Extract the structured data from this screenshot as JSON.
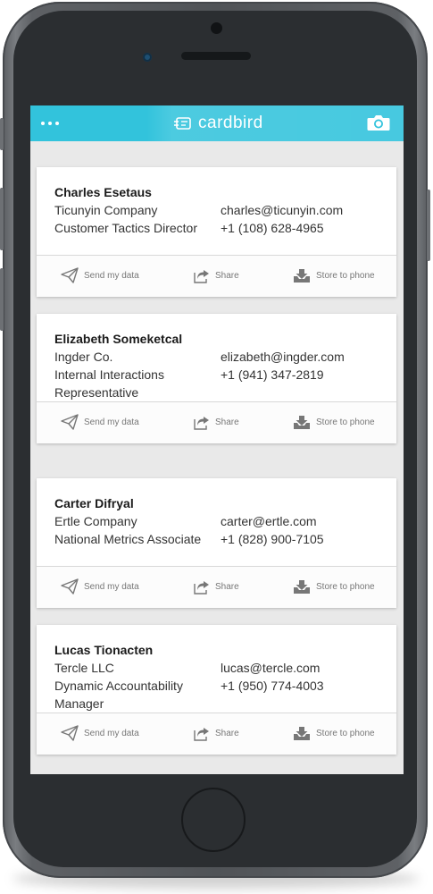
{
  "app": {
    "brand": "cardbird",
    "menu_icon": "more-dots-icon",
    "camera_icon": "camera-icon"
  },
  "colors": {
    "header": "#32c3dc",
    "background": "#e9e9e9",
    "card": "#ffffff"
  },
  "cards": [
    {
      "name": "Charles Esetaus",
      "company": "Ticunyin Company",
      "title": "Customer Tactics Director",
      "title_line2": "",
      "email": "charles@ticunyin.com",
      "phone": "+1 (108) 628-4965"
    },
    {
      "name": "Elizabeth Someketcal",
      "company": "Ingder Co.",
      "title": "Internal Interactions",
      "title_line2": "Representative",
      "email": "elizabeth@ingder.com",
      "phone": "+1 (941) 347-2819"
    },
    {
      "name": "Carter Difryal",
      "company": "Ertle Company",
      "title": "National Metrics Associate",
      "title_line2": "",
      "email": "carter@ertle.com",
      "phone": "+1 (828) 900-7105"
    },
    {
      "name": "Lucas Tionacten",
      "company": "Tercle LLC",
      "title": "Dynamic Accountability",
      "title_line2": "Manager",
      "email": "lucas@tercle.com",
      "phone": "+1 (950) 774-4003"
    }
  ],
  "actions": {
    "send": "Send my data",
    "share": "Share",
    "store": "Store to phone"
  }
}
